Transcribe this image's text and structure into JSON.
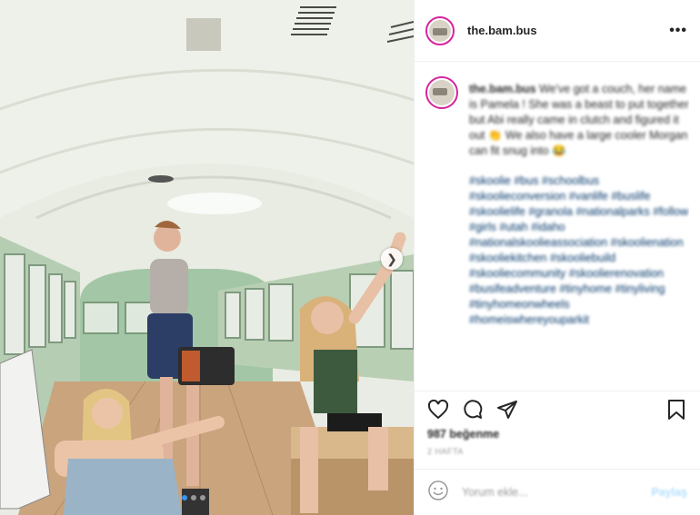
{
  "post": {
    "username": "the.bam.bus",
    "more_label": "•••"
  },
  "caption": {
    "username": "the.bam.bus",
    "text": "We've got a couch, her name is Pamela ! She was a beast to put together but Abi really came in clutch and figured it out 👏 We also have a large cooler Morgan can fit snug into 😂",
    "hashtags": "#skoolie #bus #schoolbus #skoolieconversion #vanlife #buslife #skoolielife #granola #nationalparks #follow #girls #utah #idaho #nationalskoolieassociation #skoolienation #skooliekitchen #skooliebuild #skooliecommunity #skoolierenovation #busifeadventure #tinyhome #tinyliving #tinyhomeonwheels #homeiswhereyouparkit"
  },
  "stats": {
    "likes": "987 beğenme",
    "time": "2 hafta"
  },
  "comment_box": {
    "placeholder": "Yorum ekle...",
    "post_label": "Paylaş"
  },
  "icons": [
    "heart-icon",
    "comment-icon",
    "share-icon",
    "bookmark-icon",
    "emoji-icon",
    "chevron-right-icon",
    "more-icon"
  ]
}
